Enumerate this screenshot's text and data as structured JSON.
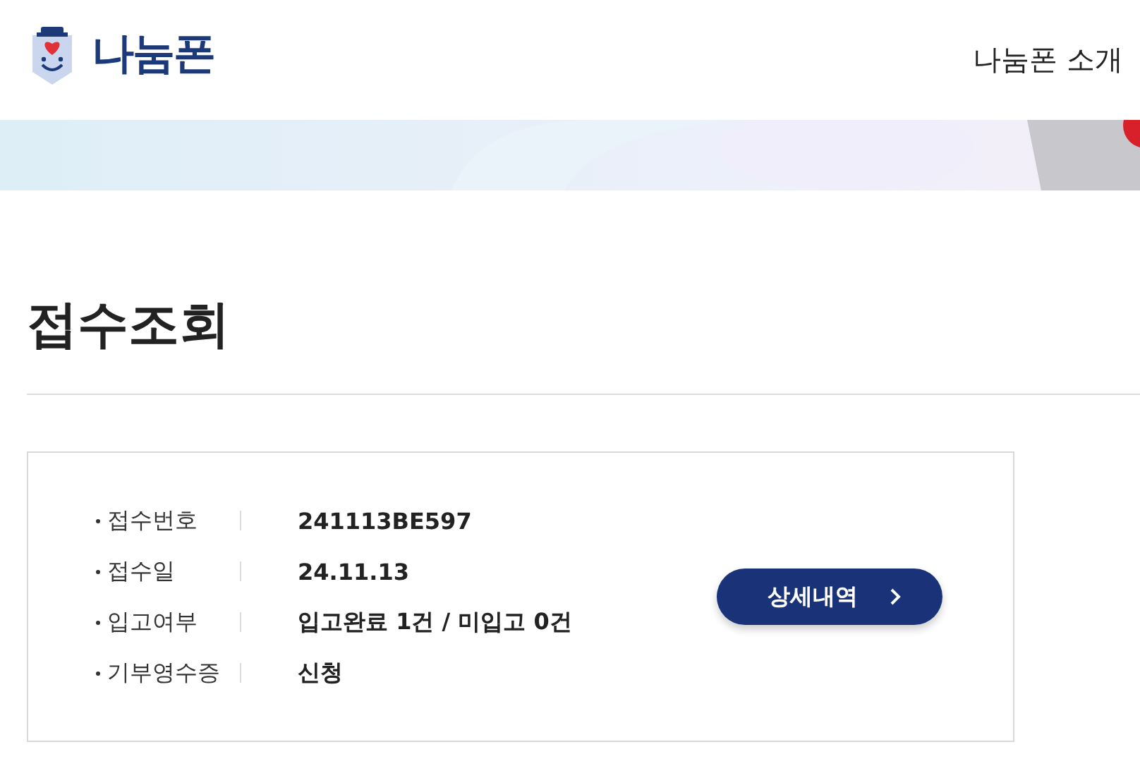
{
  "header": {
    "logo_text": "나눔폰",
    "nav": [
      {
        "label": "나눔폰 소개"
      }
    ]
  },
  "page_title": "접수조회",
  "receipt": {
    "rows": [
      {
        "label": "접수번호",
        "value": "241113BE597"
      },
      {
        "label": "접수일",
        "value": "24.11.13"
      },
      {
        "label": "입고여부",
        "value": "입고완료 1건 / 미입고 0건"
      },
      {
        "label": "기부영수증",
        "value": "신청"
      }
    ],
    "button": {
      "label": "상세내역"
    }
  }
}
